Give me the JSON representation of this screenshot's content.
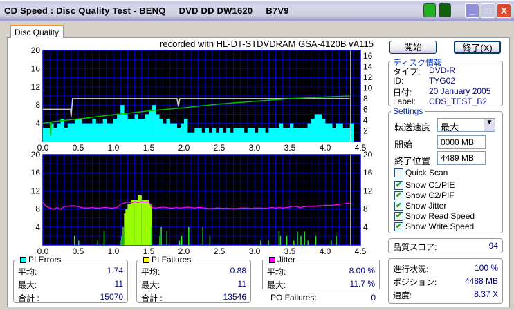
{
  "window": {
    "title": "CD Speed : Disc Quality Test - BENQ     DVD DD DW1620     B7V9",
    "minimize": "_",
    "maximize": "□",
    "close": "X"
  },
  "tab": {
    "label": "Disc Quality"
  },
  "recorded_with": "recorded with HL-DT-STDVDRAM GSA-4120B vA115",
  "buttons": {
    "start": "開始",
    "exit": "終了(X)"
  },
  "disc_info": {
    "legend": "ディスク情報",
    "rows": [
      {
        "label": "タイプ:",
        "value": "DVD-R"
      },
      {
        "label": "ID:",
        "value": "TYG02"
      },
      {
        "label": "日付:",
        "value": "20 January 2005"
      },
      {
        "label": "Label:",
        "value": "CDS_TEST_B2"
      }
    ]
  },
  "settings": {
    "legend": "Settings",
    "speed_label": "転送速度",
    "speed_value": "最大",
    "start_label": "開始",
    "start_value": "0000 MB",
    "end_label": "終了位置",
    "end_value": "4489 MB",
    "checkboxes": [
      {
        "label": "Quick Scan",
        "checked": false
      },
      {
        "label": "Show C1/PIE",
        "checked": true
      },
      {
        "label": "Show C2/PIF",
        "checked": true
      },
      {
        "label": "Show Jitter",
        "checked": true
      },
      {
        "label": "Show Read Speed",
        "checked": true
      },
      {
        "label": "Show Write Speed",
        "checked": true
      }
    ]
  },
  "quality": {
    "label": "品質スコア:",
    "value": "94"
  },
  "progress": {
    "rows": [
      {
        "label": "進行状況:",
        "value": "100 %"
      },
      {
        "label": "ポジション:",
        "value": "4488 MB"
      },
      {
        "label": "速度:",
        "value": "8.37 X"
      }
    ]
  },
  "pi_errors": {
    "legend": "PI Errors",
    "color": "#00ffff",
    "rows": [
      {
        "label": "平均:",
        "value": "1.74"
      },
      {
        "label": "最大:",
        "value": "11"
      },
      {
        "label": "合計 :",
        "value": "15070"
      }
    ]
  },
  "pi_failures": {
    "legend": "PI Failures",
    "color": "#ffff00",
    "rows": [
      {
        "label": "平均:",
        "value": "0.88"
      },
      {
        "label": "最大:",
        "value": "11"
      },
      {
        "label": "合計 :",
        "value": "13546"
      }
    ]
  },
  "jitter": {
    "legend": "Jitter",
    "color": "#ff00ff",
    "rows": [
      {
        "label": "平均:",
        "value": "8.00 %"
      },
      {
        "label": "最大:",
        "value": "11.7 %"
      }
    ]
  },
  "po_failures": {
    "label": "PO Failures:",
    "value": "0"
  },
  "chart_data": [
    {
      "type": "bar",
      "xlim": [
        0,
        4.5
      ],
      "ylim": [
        0,
        20
      ],
      "y2lim": [
        0,
        17
      ],
      "grid": true,
      "xticks": [
        "0.0",
        "0.5",
        "1.0",
        "1.5",
        "2.0",
        "2.5",
        "3.0",
        "3.5",
        "4.0",
        "4.5"
      ],
      "yticks": [
        "4",
        "8",
        "12",
        "16",
        "20"
      ],
      "y2ticks": [
        "2",
        "4",
        "6",
        "8",
        "10",
        "12",
        "14",
        "16"
      ],
      "pie": {
        "color": "#00ffff",
        "step": 0.05,
        "values": [
          3,
          3,
          4,
          3,
          4,
          5,
          3,
          4,
          4,
          5,
          5,
          4,
          4,
          4,
          5,
          4,
          4,
          5,
          4,
          4,
          5,
          6,
          8,
          6,
          5,
          5,
          6,
          5,
          5,
          6,
          7,
          8,
          6,
          5,
          4,
          5,
          4,
          4,
          3,
          4,
          5,
          2,
          2,
          3,
          3,
          2,
          3,
          2,
          3,
          2,
          3,
          2,
          3,
          2,
          3,
          3,
          3,
          2,
          3,
          3,
          2,
          3,
          3,
          2,
          3,
          3,
          3,
          4,
          3,
          3,
          4,
          3,
          3,
          3,
          3,
          4,
          5,
          6,
          6,
          5,
          4,
          4,
          3,
          4,
          4,
          3,
          3,
          4
        ]
      },
      "write_speed": {
        "color": "#d0d0d0",
        "points": [
          [
            0,
            6
          ],
          [
            0.39,
            6
          ],
          [
            0.4,
            4.6
          ],
          [
            0.42,
            8
          ],
          [
            1.9,
            8
          ],
          [
            1.92,
            6.5
          ],
          [
            1.94,
            8
          ],
          [
            4.35,
            8
          ]
        ]
      },
      "read_speed": {
        "color": "#00c000",
        "points": [
          [
            0,
            3.4
          ],
          [
            0.1,
            3.6
          ],
          [
            0.11,
            1
          ],
          [
            0.12,
            3.7
          ],
          [
            0.5,
            4.2
          ],
          [
            1,
            5
          ],
          [
            1.5,
            5.7
          ],
          [
            2,
            6.3
          ],
          [
            2.5,
            7
          ],
          [
            3,
            7.5
          ],
          [
            3.5,
            8
          ],
          [
            4,
            8.3
          ],
          [
            4.35,
            8.5
          ]
        ]
      },
      "end_marker": 4.36
    },
    {
      "type": "bar",
      "xlim": [
        0,
        4.5
      ],
      "ylim": [
        0,
        20
      ],
      "grid": true,
      "xticks": [
        "0.0",
        "0.5",
        "1.0",
        "1.5",
        "2.0",
        "2.5",
        "3.0",
        "3.5",
        "4.0",
        "4.5"
      ],
      "yticks": [
        "4",
        "8",
        "12",
        "16",
        "20"
      ],
      "y2ticks": [
        "4",
        "8",
        "12",
        "16",
        "20"
      ],
      "pif": {
        "color": "#99ff00",
        "points": [
          [
            0.44,
            2
          ],
          [
            0.5,
            1
          ],
          [
            0.77,
            1
          ],
          [
            0.86,
            3
          ],
          [
            1.09,
            1
          ],
          [
            1.11,
            2
          ],
          [
            1.13,
            4
          ],
          [
            1.15,
            7
          ],
          [
            1.17,
            8
          ],
          [
            1.2,
            9
          ],
          [
            1.25,
            10
          ],
          [
            1.3,
            10
          ],
          [
            1.35,
            11
          ],
          [
            1.4,
            10
          ],
          [
            1.45,
            10
          ],
          [
            1.5,
            9
          ],
          [
            1.53,
            4
          ],
          [
            1.65,
            2
          ],
          [
            1.67,
            4
          ],
          [
            1.75,
            3
          ],
          [
            1.93,
            1
          ],
          [
            1.96,
            2
          ],
          [
            2.06,
            4
          ],
          [
            2.26,
            4
          ],
          [
            2.36,
            2
          ],
          [
            3.08,
            1
          ],
          [
            3.19,
            1
          ],
          [
            3.34,
            3
          ],
          [
            3.36,
            2
          ],
          [
            3.45,
            2
          ],
          [
            3.55,
            1
          ],
          [
            3.6,
            3
          ],
          [
            3.65,
            2
          ],
          [
            3.7,
            3
          ],
          [
            3.75,
            1
          ],
          [
            3.86,
            2
          ],
          [
            4.08,
            1
          ],
          [
            4.15,
            2
          ]
        ]
      },
      "jitter": {
        "color": "#ff00ff",
        "step": 0.05,
        "values": [
          9.5,
          8.5,
          8.2,
          8,
          8.3,
          8,
          8.5,
          8.6,
          8.7,
          8.7,
          8.5,
          8.3,
          8.2,
          8.2,
          8.3,
          8.2,
          8.2,
          8.3,
          8.3,
          8.2,
          8.2,
          8.3,
          9,
          9.3,
          9.5,
          9.3,
          9.6,
          9.4,
          9.6,
          9.5,
          9.6,
          8.3,
          8.2,
          8.3,
          8.4,
          8.3,
          8.2,
          8.2,
          8.3,
          8.2,
          8.3,
          8.4,
          8.3,
          8.2,
          8.3,
          8.3,
          8.2,
          8.1,
          8.1,
          8.2,
          8.2,
          8.1,
          8.2,
          8.1,
          8.1,
          8.1,
          8.2,
          8.2,
          8.2,
          8.1,
          8.2,
          8.2,
          8.2,
          8.1,
          8.2,
          8.3,
          8.2,
          8.3,
          8.2,
          8.3,
          8.4,
          8.6,
          8.5,
          8.3,
          8.5,
          8.6,
          8.6,
          8.6,
          8.7,
          8.7,
          8.8,
          8.8,
          8.8,
          8.9,
          9,
          9.1,
          9.2,
          9.3
        ]
      },
      "end_marker": 4.36
    }
  ]
}
